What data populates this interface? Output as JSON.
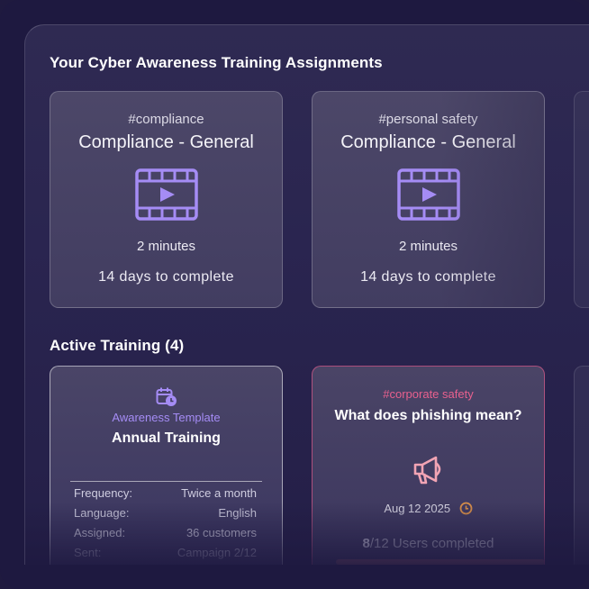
{
  "assignments": {
    "title": "Your Cyber Awareness Training Assignments",
    "cards": [
      {
        "tag": "#compliance",
        "title": "Compliance - General",
        "icon": "video-icon",
        "duration": "2 minutes",
        "deadline": "14 days to complete"
      },
      {
        "tag": "#personal safety",
        "title": "Compliance - General",
        "icon": "video-icon",
        "duration": "2 minutes",
        "deadline": "14 days to complete"
      }
    ]
  },
  "active": {
    "title": "Active Training (4)",
    "template_card": {
      "icon": "calendar-clock-icon",
      "type_label": "Awareness Template",
      "title": "Annual Training",
      "rows": [
        {
          "key": "Frequency:",
          "value": "Twice a month"
        },
        {
          "key": "Language:",
          "value": "English"
        },
        {
          "key": "Assigned:",
          "value": "36 customers"
        },
        {
          "key": "Sent:",
          "value": "Campaign 2/12"
        }
      ]
    },
    "phishing_card": {
      "tag": "#corporate safety",
      "title": "What does phishing mean?",
      "icon": "megaphone-icon",
      "date": "Aug 12 2025",
      "date_icon": "clock-icon",
      "completed_count": "8",
      "completed_suffix": "/12 Users completed",
      "progress": 0.6667
    }
  },
  "colors": {
    "accent_purple": "#a58cf5",
    "accent_pink": "#e8608e",
    "clock_orange": "#d9904a"
  }
}
